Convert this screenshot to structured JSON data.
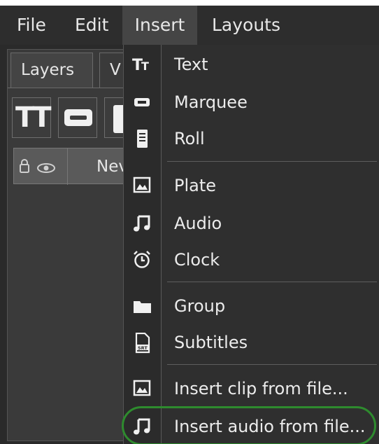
{
  "menubar": {
    "items": [
      {
        "label": "File"
      },
      {
        "label": "Edit"
      },
      {
        "label": "Insert"
      },
      {
        "label": "Layouts"
      }
    ]
  },
  "left_panel": {
    "tabs": [
      {
        "label": "Layers"
      },
      {
        "label": "V"
      }
    ],
    "tool_buttons": [
      "text-tool-icon",
      "marquee-tool-icon",
      "roll-tool-icon"
    ],
    "layer_header": {
      "lock_eye": "🔒 👁",
      "name": "Nev"
    }
  },
  "insert_menu": {
    "items": [
      {
        "label": "Text",
        "icon": "text-icon"
      },
      {
        "label": "Marquee",
        "icon": "marquee-icon"
      },
      {
        "label": "Roll",
        "icon": "roll-icon"
      },
      {
        "label": "Plate",
        "icon": "image-icon"
      },
      {
        "label": "Audio",
        "icon": "music-note-icon"
      },
      {
        "label": "Clock",
        "icon": "alarm-clock-icon"
      },
      {
        "label": "Group",
        "icon": "folder-icon"
      },
      {
        "label": "Subtitles",
        "icon": "subtitle-file-icon"
      },
      {
        "label": "Insert clip from file...",
        "icon": "image-icon"
      },
      {
        "label": "Insert audio from file...",
        "icon": "music-note-icon"
      }
    ]
  },
  "colors": {
    "menubar_bg": "#2d2d2d",
    "menu_bg": "#2f2f2f",
    "highlight_ring": "#2e8b2e"
  }
}
